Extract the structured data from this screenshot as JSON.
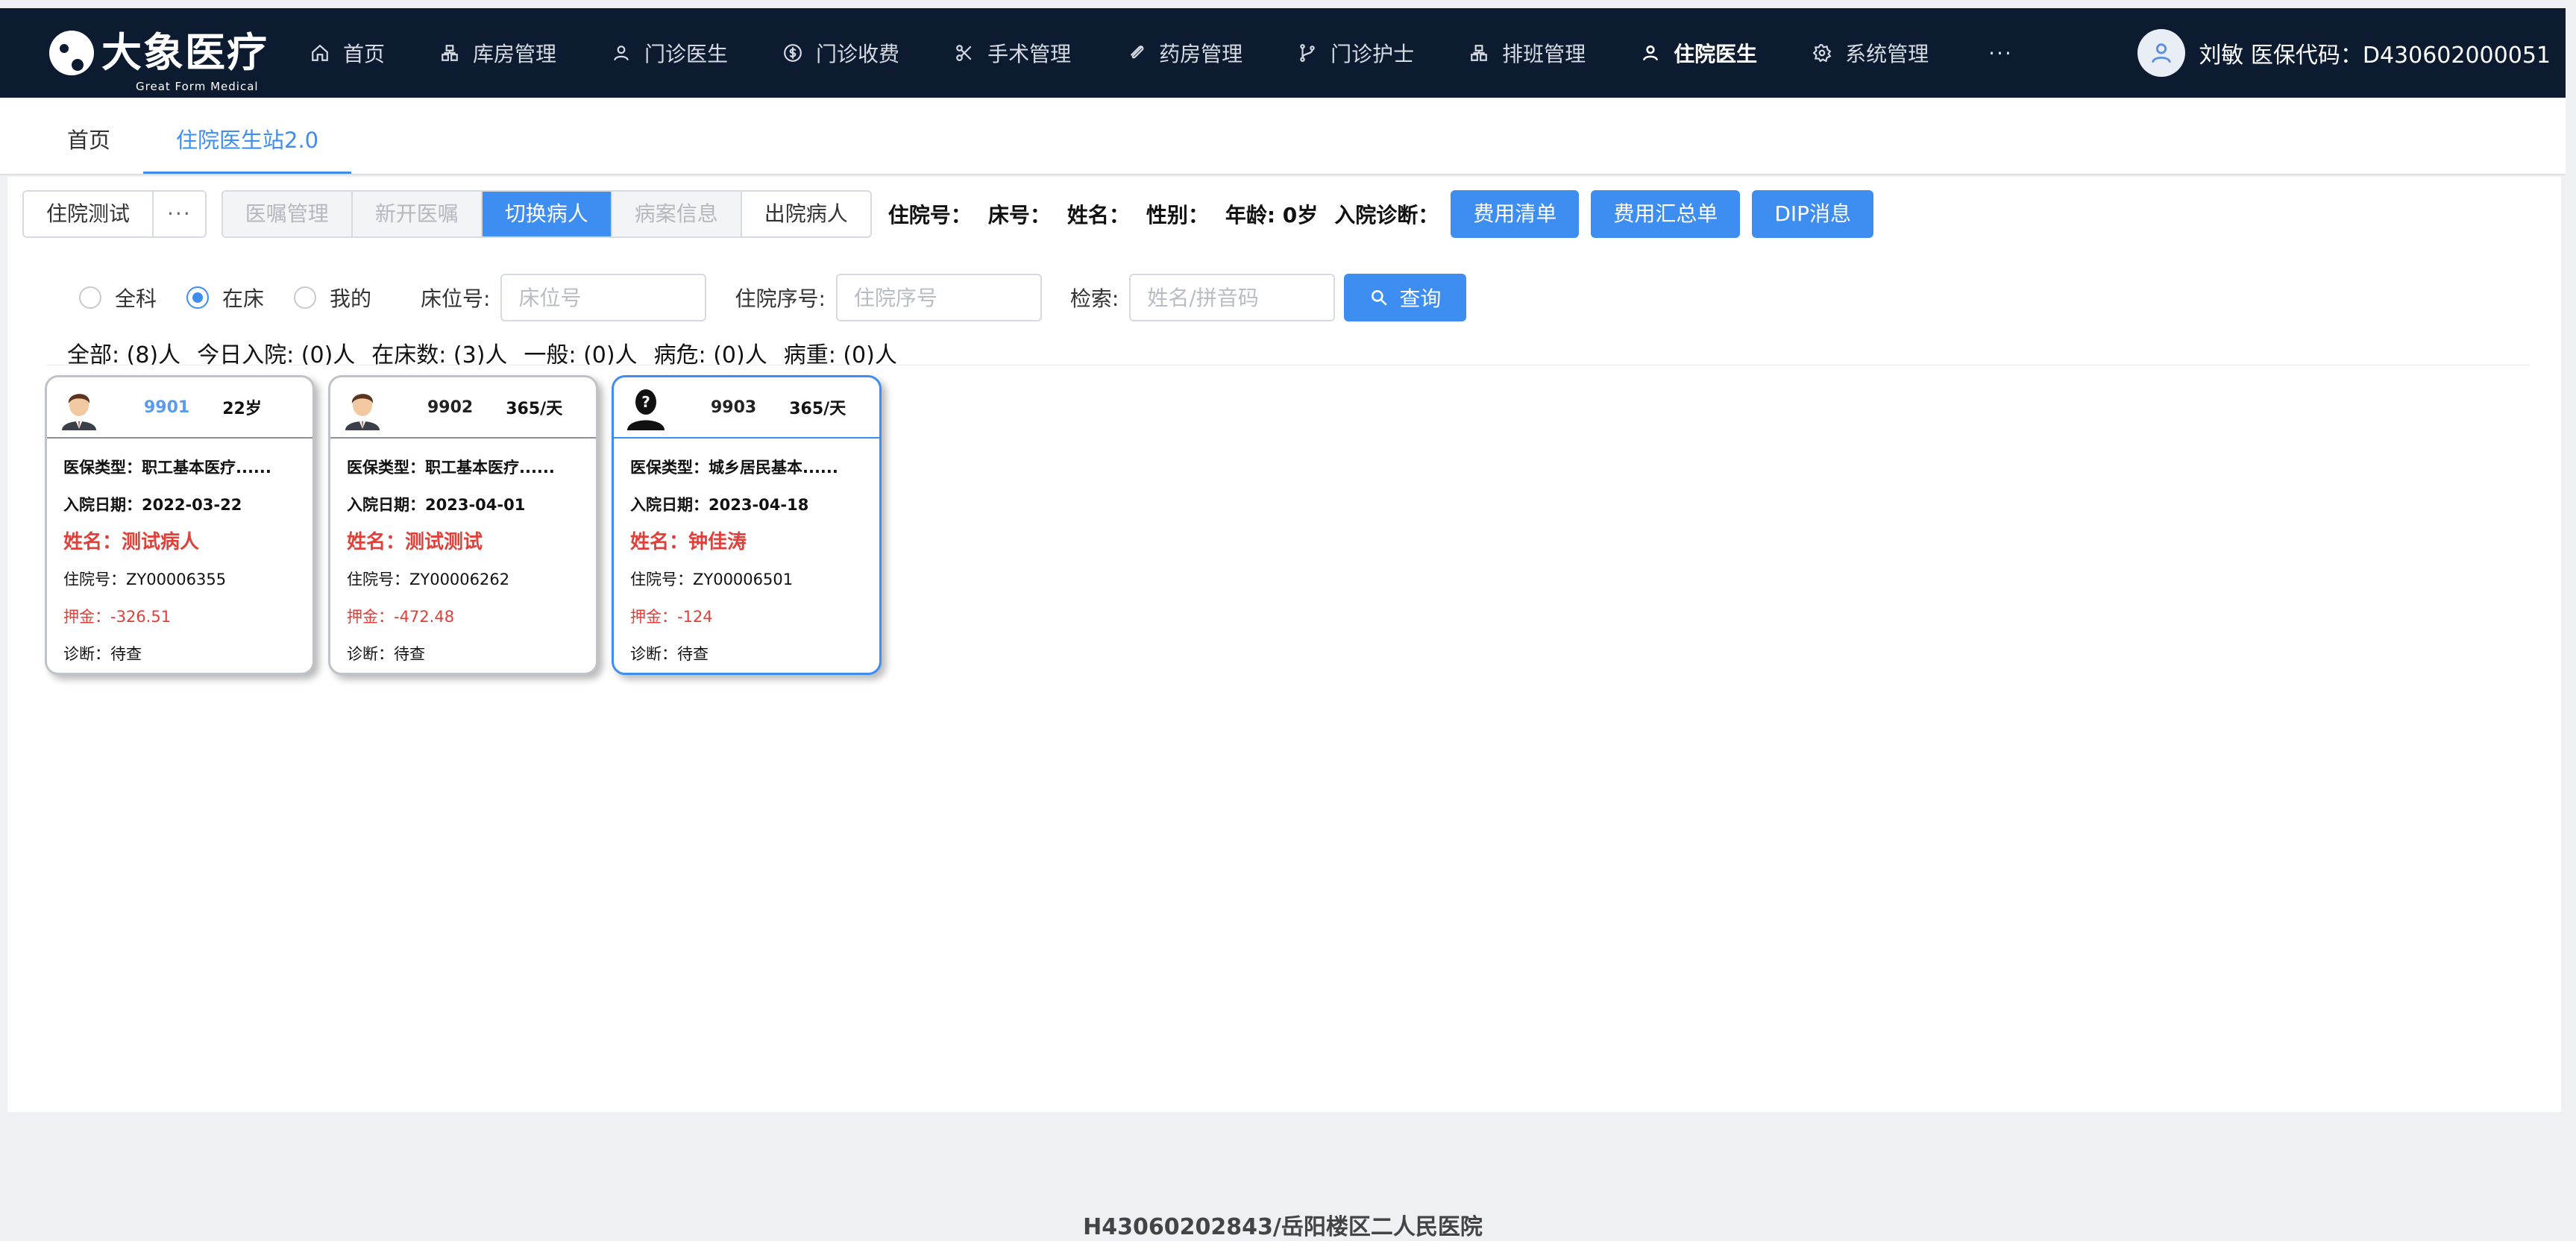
{
  "app": {
    "logo_cn": "大象医疗",
    "logo_en": "Great Form Medical"
  },
  "nav": {
    "items": [
      {
        "label": "首页",
        "icon": "home-icon"
      },
      {
        "label": "库房管理",
        "icon": "warehouse-icon"
      },
      {
        "label": "门诊医生",
        "icon": "user-icon"
      },
      {
        "label": "门诊收费",
        "icon": "dollar-icon"
      },
      {
        "label": "手术管理",
        "icon": "scissors-icon"
      },
      {
        "label": "药房管理",
        "icon": "pill-icon"
      },
      {
        "label": "门诊护士",
        "icon": "branch-icon"
      },
      {
        "label": "排班管理",
        "icon": "schedule-icon"
      },
      {
        "label": "住院医生",
        "icon": "user-icon",
        "active": true
      },
      {
        "label": "系统管理",
        "icon": "gear-icon"
      }
    ],
    "more": "···",
    "user_text": "刘敏 医保代码：D430602000051"
  },
  "page_tabs": [
    "首页",
    "住院医生站2.0"
  ],
  "toolbar": {
    "ward_label": "住院测试",
    "ward_more": "···",
    "buttons": [
      {
        "label": "医嘱管理",
        "state": "disabled"
      },
      {
        "label": "新开医嘱",
        "state": "disabled"
      },
      {
        "label": "切换病人",
        "state": "active"
      },
      {
        "label": "病案信息",
        "state": "disabled"
      },
      {
        "label": "出院病人",
        "state": "normal"
      }
    ],
    "patient_info": {
      "admission_no": "住院号：",
      "bed_no": "床号：",
      "name": "姓名：",
      "gender": "性别：",
      "age": "年龄: 0岁",
      "diagnosis": "入院诊断："
    },
    "actions": [
      "费用清单",
      "费用汇总单",
      "DIP消息"
    ]
  },
  "filter": {
    "radios": [
      {
        "label": "全科",
        "selected": false
      },
      {
        "label": "在床",
        "selected": true
      },
      {
        "label": "我的",
        "selected": false
      }
    ],
    "bed_label": "床位号:",
    "bed_placeholder": "床位号",
    "seq_label": "住院序号:",
    "seq_placeholder": "住院序号",
    "search_label": "检索:",
    "search_placeholder": "姓名/拼音码",
    "search_button": "查询"
  },
  "summary": {
    "all": "全部:  (8)人",
    "today": "今日入院:  (0)人",
    "in_bed": "在床数:  (3)人",
    "normal": "一般:  (0)人",
    "critical": "病危:  (0)人",
    "severe": "病重:  (0)人"
  },
  "cards": [
    {
      "avatar": "male-avatar-icon",
      "bed": "9901",
      "age": "22岁",
      "insurance": "医保类型：职工基本医疗......",
      "admit_date": "入院日期：2022-03-22",
      "name": "姓名：测试病人",
      "admission_no": "住院号：ZY00006355",
      "deposit": "押金：-326.51",
      "diagnosis": "诊断：待查"
    },
    {
      "avatar": "male-avatar-icon",
      "bed": "9902",
      "age": "365/天",
      "insurance": "医保类型：职工基本医疗......",
      "admit_date": "入院日期：2023-04-01",
      "name": "姓名：测试测试",
      "admission_no": "住院号：ZY00006262",
      "deposit": "押金：-472.48",
      "diagnosis": "诊断：待查"
    },
    {
      "avatar": "unknown-avatar-icon",
      "bed": "9903",
      "age": "365/天",
      "insurance": "医保类型：城乡居民基本......",
      "admit_date": "入院日期：2023-04-18",
      "name": "姓名：钟佳涛",
      "admission_no": "住院号：ZY00006501",
      "deposit": "押金：-124",
      "diagnosis": "诊断：待查"
    }
  ],
  "footer": "H43060202843/岳阳楼区二人民医院",
  "colors": {
    "nav_bg": "#0c1b30",
    "accent": "#3d8ef0",
    "danger": "#e0403a"
  }
}
